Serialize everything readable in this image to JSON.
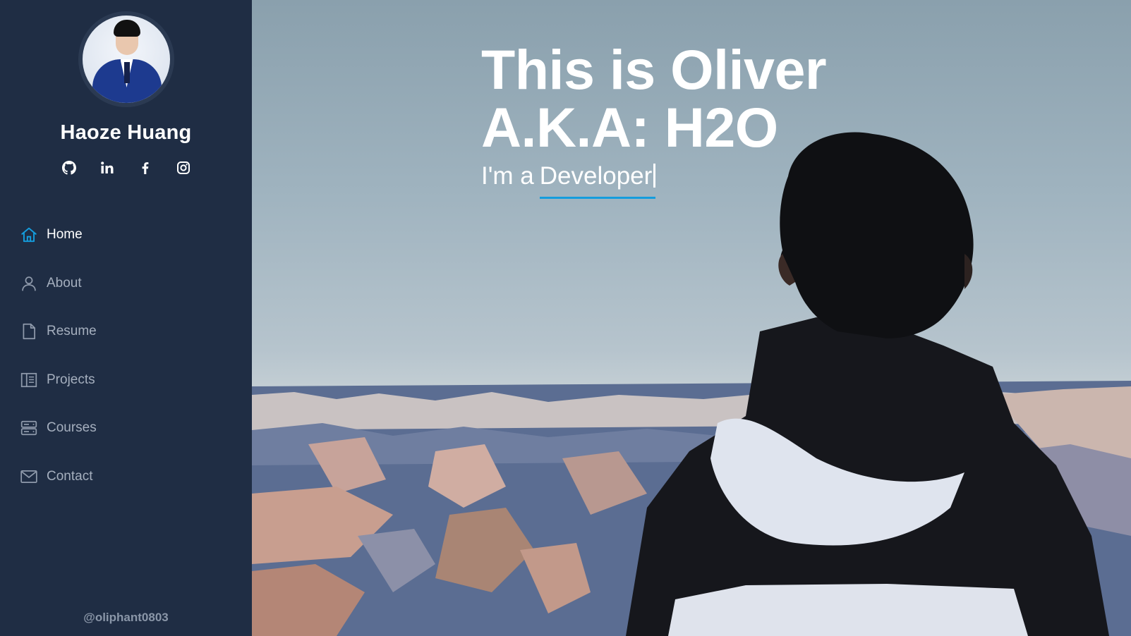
{
  "profile": {
    "name": "Haoze Huang",
    "avatar_icon": "profile-photo"
  },
  "social": [
    {
      "name": "github",
      "icon": "github-icon"
    },
    {
      "name": "linkedin",
      "icon": "linkedin-icon"
    },
    {
      "name": "facebook",
      "icon": "facebook-icon"
    },
    {
      "name": "instagram",
      "icon": "instagram-icon"
    }
  ],
  "nav": {
    "items": [
      {
        "label": "Home",
        "icon": "home-icon",
        "active": true
      },
      {
        "label": "About",
        "icon": "user-icon",
        "active": false
      },
      {
        "label": "Resume",
        "icon": "file-icon",
        "active": false
      },
      {
        "label": "Projects",
        "icon": "book-icon",
        "active": false
      },
      {
        "label": "Courses",
        "icon": "server-icon",
        "active": false
      },
      {
        "label": "Contact",
        "icon": "envelope-icon",
        "active": false
      }
    ]
  },
  "footer": {
    "handle": "@oliphant0803"
  },
  "hero": {
    "title_line1": "This is Oliver",
    "title_line2": "A.K.A: H2O",
    "typed_prefix": "I'm a",
    "typed_word": "Developer"
  },
  "colors": {
    "sidebar_bg": "#1f2d44",
    "accent": "#149ddd",
    "nav_text": "#a5afbe",
    "active_text": "#ffffff"
  }
}
